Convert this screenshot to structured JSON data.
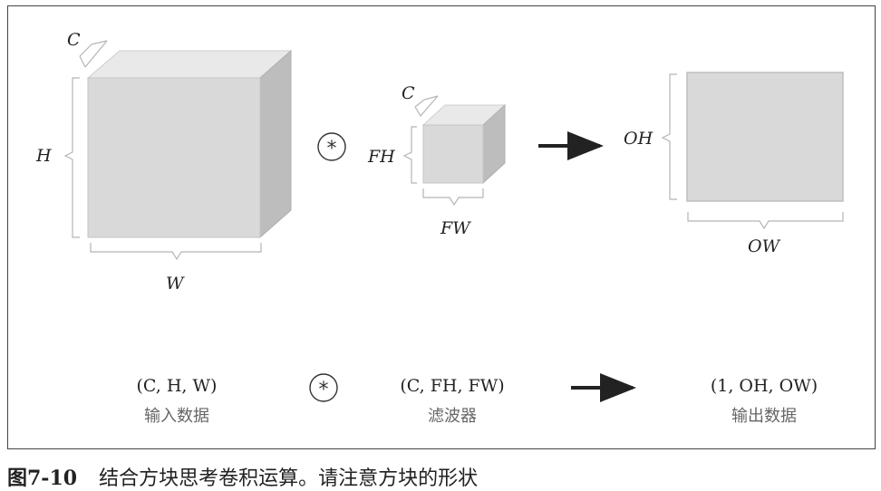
{
  "caption": {
    "figure_number": "图7-10",
    "text": "结合方块思考卷积运算。请注意方块的形状"
  },
  "diagram": {
    "input": {
      "label_c": "C",
      "label_h": "H",
      "label_w": "W",
      "shape": "(C, H, W)",
      "name": "输入数据"
    },
    "filter": {
      "label_c": "C",
      "label_fh": "FH",
      "label_fw": "FW",
      "shape": "(C, FH, FW)",
      "name": "滤波器"
    },
    "output": {
      "label_oh": "OH",
      "label_ow": "OW",
      "shape": "(1, OH, OW)",
      "name": "输出数据"
    },
    "operator_symbol": "*",
    "colors": {
      "front": "#d9d9d9",
      "top": "#e9e9e9",
      "side": "#bdbdbd",
      "bracket": "#b5b5b5",
      "arrow": "#222222"
    }
  }
}
